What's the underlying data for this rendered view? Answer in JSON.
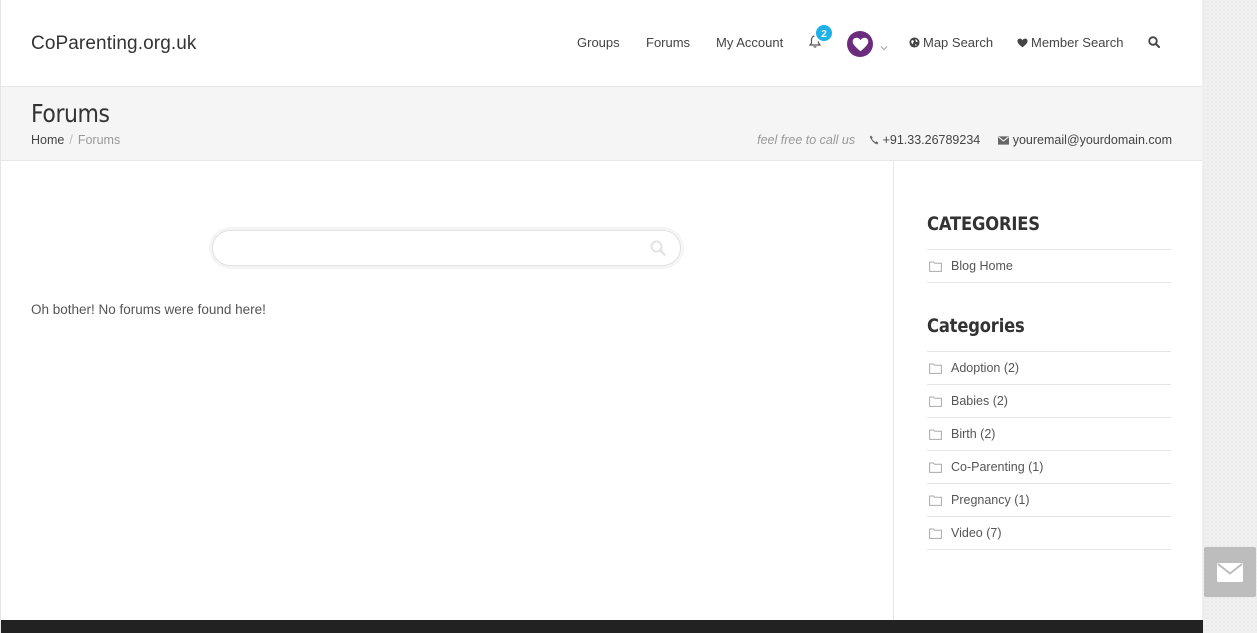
{
  "header": {
    "logo": "CoParenting.org.uk",
    "nav": {
      "groups": "Groups",
      "forums": "Forums",
      "my_account": "My Account",
      "notification_count": "2",
      "map_search": "Map Search",
      "member_search": "Member Search"
    }
  },
  "titlebar": {
    "title": "Forums",
    "breadcrumb": {
      "home": "Home",
      "separator": "/",
      "current": "Forums"
    },
    "contact": {
      "tagline": "feel free to call us",
      "phone": "+91.33.26789234",
      "email": "youremail@yourdomain.com"
    }
  },
  "main": {
    "search": {
      "value": "",
      "placeholder": ""
    },
    "empty_message": "Oh bother! No forums were found here!"
  },
  "sidebar": {
    "section1": {
      "title": "CATEGORIES",
      "items": [
        {
          "label": "Blog Home"
        }
      ]
    },
    "section2": {
      "title": "Categories",
      "items": [
        {
          "label": "Adoption (2)"
        },
        {
          "label": "Babies (2)"
        },
        {
          "label": "Birth (2)"
        },
        {
          "label": "Co-Parenting (1)"
        },
        {
          "label": "Pregnancy (1)"
        },
        {
          "label": "Video (7)"
        }
      ]
    }
  },
  "colors": {
    "badge": "#1eb0e8",
    "avatar": "#6b2c7e",
    "footer": "#222222"
  }
}
